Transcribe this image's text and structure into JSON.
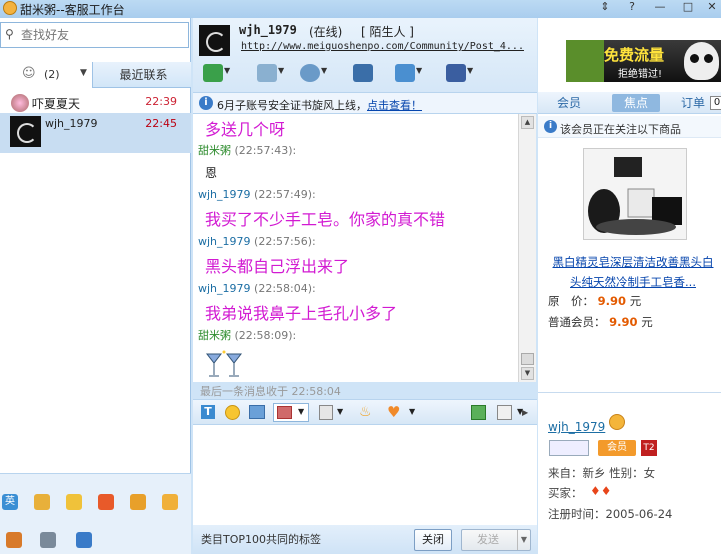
{
  "window": {
    "title": "甜米粥--客服工作台",
    "buttons": [
      "⇕",
      "?",
      "—",
      "□",
      "✕"
    ]
  },
  "left": {
    "search_placeholder": "查找好友",
    "tab_contacts": {
      "count": "(2)"
    },
    "tab_recent": "最近联系",
    "contacts": [
      {
        "name": "吓夏夏天",
        "time": "22:39"
      },
      {
        "name": "wjh_1979",
        "time": "22:45"
      }
    ]
  },
  "chat_header": {
    "user": "wjh_1979",
    "status": "(在线)",
    "stranger": "[ 陌生人 ]",
    "url": "http://www.meiguoshenpo.com/Community/Post_4..."
  },
  "notice": {
    "text": "6月子账号安全证书旋风上线，",
    "link": "点击查看！"
  },
  "messages": [
    {
      "kind": "text",
      "text": "多送几个呀"
    },
    {
      "kind": "header",
      "user": "甜米粥",
      "time": "(22:57:43):"
    },
    {
      "kind": "small",
      "text": "恩"
    },
    {
      "kind": "header",
      "user": "wjh_1979",
      "time": "(22:57:49):"
    },
    {
      "kind": "text",
      "text": "我买了不少手工皂。你家的真不错"
    },
    {
      "kind": "header",
      "user": "wjh_1979",
      "time": "(22:57:56):"
    },
    {
      "kind": "text",
      "text": "黑头都自己浮出来了"
    },
    {
      "kind": "header",
      "user": "wjh_1979",
      "time": "(22:58:04):"
    },
    {
      "kind": "text",
      "text": "我弟说我鼻子上毛孔小多了"
    },
    {
      "kind": "header",
      "user": "甜米粥",
      "time": "(22:58:09):"
    }
  ],
  "last_msg": "最后一条消息收于 22:58:04",
  "bottom": {
    "tag_text": "类目TOP100共同的标签",
    "close": "关闭",
    "send": "发送"
  },
  "right": {
    "banner": {
      "line1": "免费流量",
      "line2": "拒绝错过!"
    },
    "tabs": [
      "会员",
      "焦点",
      "订单"
    ],
    "tab_badge": "0",
    "notice": "该会员正在关注以下商品",
    "product": {
      "title": "黑白精灵皂深层清洁改善黑头白头纯天然冷制手工皂香...",
      "price_label": "原　价：",
      "price": "9.90",
      "member_label": "普通会员：",
      "member_price": "9.90",
      "unit": "元"
    },
    "user": {
      "name": "wjh_1979",
      "from_label": "来自：",
      "from": "新乡",
      "gender_label": "性别：",
      "gender": "女",
      "buyer_label": "买家：",
      "reg_label": "注册时间：",
      "reg": "2005-06-24",
      "vip_badge": "会员",
      "t2_badge": "T2"
    }
  }
}
